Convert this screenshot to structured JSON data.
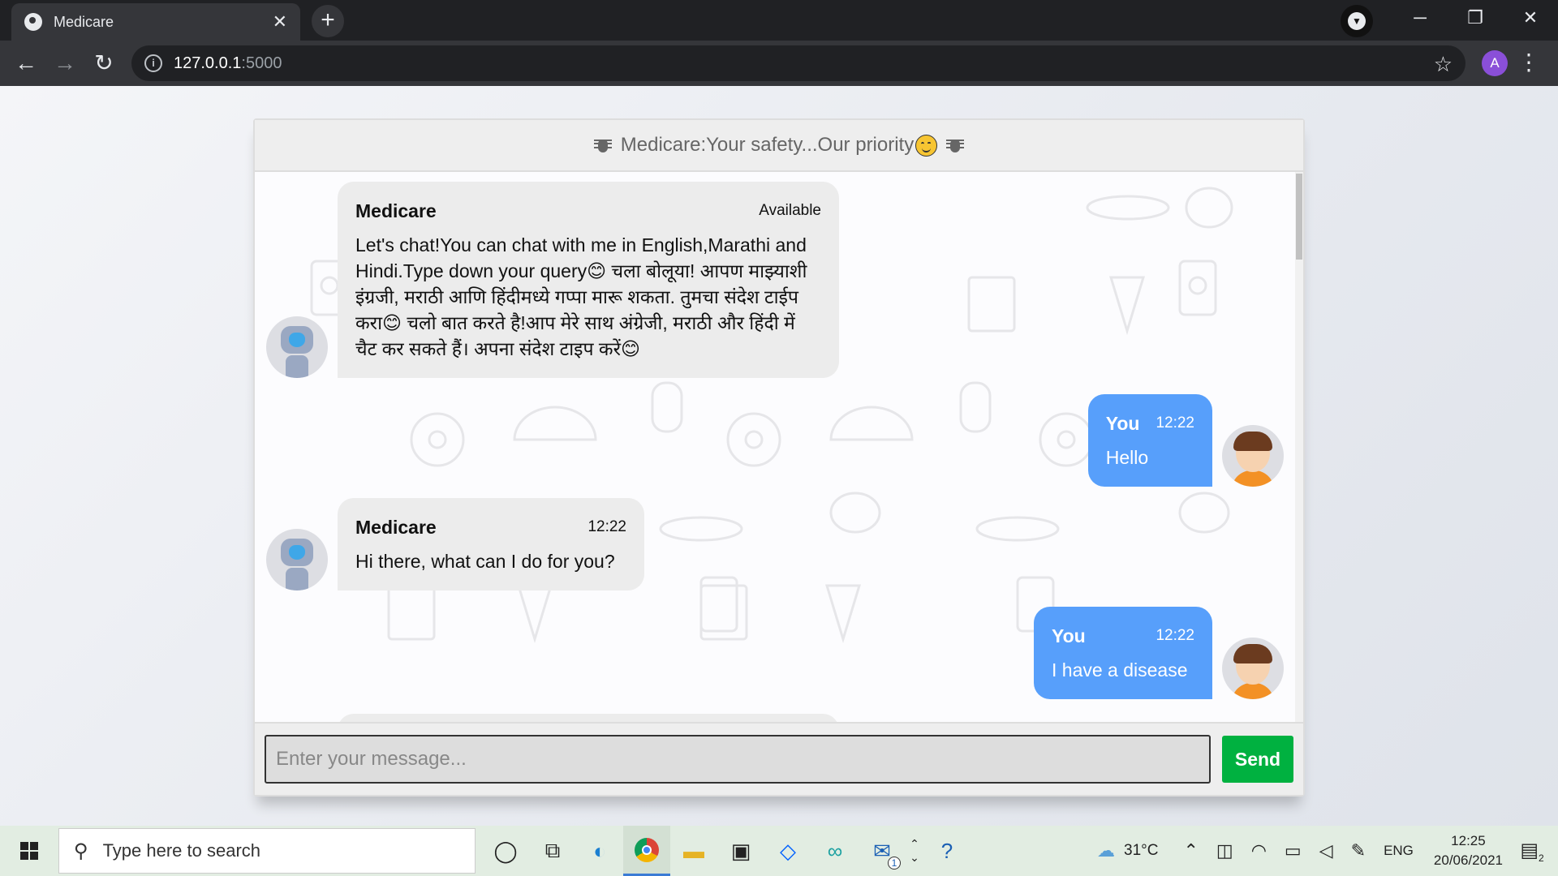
{
  "browser": {
    "tab_title": "Medicare",
    "tab_close": "✕",
    "new_tab": "+",
    "url_host": "127.0.0.1",
    "url_port": ":5000",
    "profile_initial": "A",
    "win_minimize": "─",
    "win_restore": "❐",
    "win_close": "✕",
    "back": "←",
    "forward": "→",
    "reload": "↻",
    "star": "☆",
    "menu": "⋮",
    "info": "i"
  },
  "chat": {
    "header_title": "Medicare:Your safety...Our priority",
    "messages": [
      {
        "side": "left",
        "name": "Medicare",
        "time": "Available",
        "text": "Let's chat!You can chat with me in English,Marathi and Hindi.Type down your query😊 चला बोलूया! आपण माझ्याशी इंग्रजी, मराठी आणि हिंदीमध्ये गप्पा मारू शकता. तुमचा संदेश टाईप करा😊 चलो बात करते है!आप मेरे साथ अंग्रेजी, मराठी और हिंदी में चैट कर सकते हैं। अपना संदेश टाइप करें😊"
      },
      {
        "side": "right",
        "name": "You",
        "time": "12:22",
        "text": "Hello"
      },
      {
        "side": "left",
        "name": "Medicare",
        "time": "12:22",
        "text": "Hi there, what can I do for you?"
      },
      {
        "side": "right",
        "name": "You",
        "time": "12:22",
        "text": "I have a disease"
      }
    ],
    "input_placeholder": "Enter your message...",
    "send_label": "Send"
  },
  "taskbar": {
    "search_placeholder": "Type here to search",
    "weather": "31°C",
    "language": "ENG",
    "time": "12:25",
    "date": "20/06/2021",
    "mail_badge": "1",
    "notification_count": "2"
  }
}
